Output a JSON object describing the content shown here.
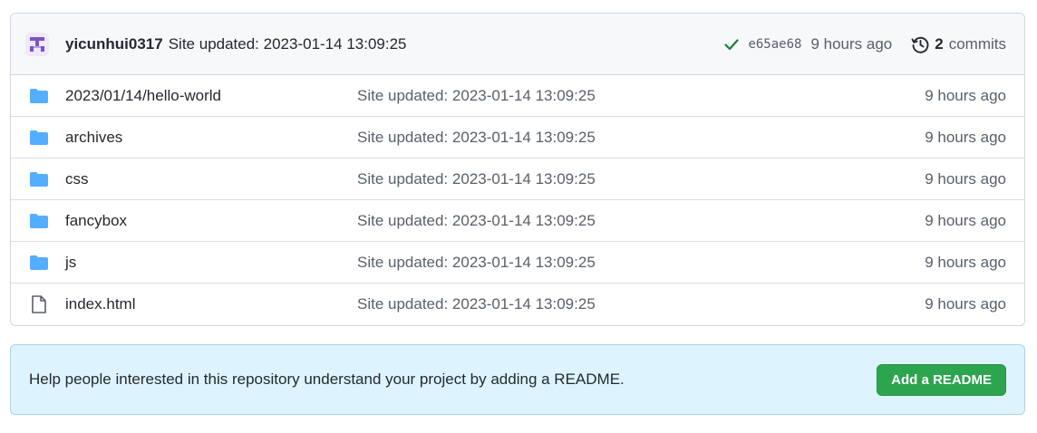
{
  "commit": {
    "author": "yicunhui0317",
    "message": "Site updated: 2023-01-14 13:09:25",
    "status_icon": "check-icon",
    "sha": "e65ae68",
    "age": "9 hours ago",
    "history_icon": "history-icon",
    "commit_count": "2",
    "commits_label": "commits"
  },
  "files": [
    {
      "type": "folder",
      "name": "2023/01/14/hello-world",
      "message": "Site updated: 2023-01-14 13:09:25",
      "age": "9 hours ago"
    },
    {
      "type": "folder",
      "name": "archives",
      "message": "Site updated: 2023-01-14 13:09:25",
      "age": "9 hours ago"
    },
    {
      "type": "folder",
      "name": "css",
      "message": "Site updated: 2023-01-14 13:09:25",
      "age": "9 hours ago"
    },
    {
      "type": "folder",
      "name": "fancybox",
      "message": "Site updated: 2023-01-14 13:09:25",
      "age": "9 hours ago"
    },
    {
      "type": "folder",
      "name": "js",
      "message": "Site updated: 2023-01-14 13:09:25",
      "age": "9 hours ago"
    },
    {
      "type": "file",
      "name": "index.html",
      "message": "Site updated: 2023-01-14 13:09:25",
      "age": "9 hours ago"
    }
  ],
  "readme": {
    "text": "Help people interested in this repository understand your project by adding a README.",
    "button_label": "Add a README"
  },
  "colors": {
    "folder": "#54aeff",
    "success": "#1a7f37",
    "button": "#2da44e",
    "banner": "#ddf4ff"
  }
}
